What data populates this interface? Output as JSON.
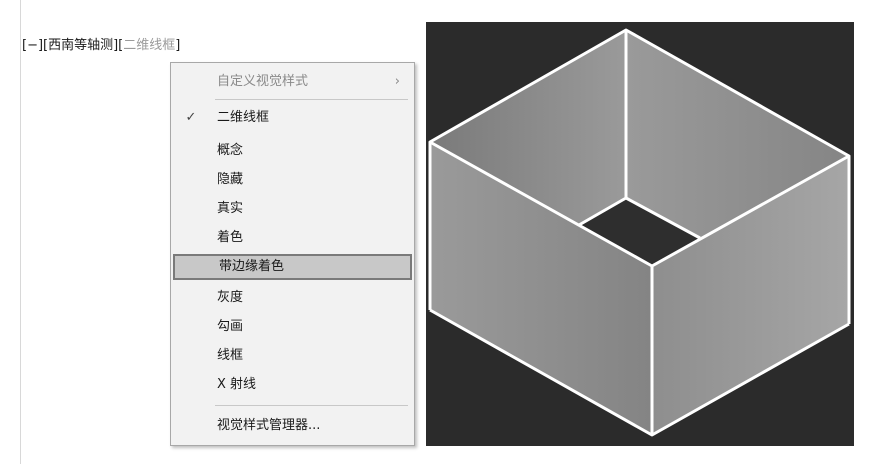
{
  "viewport_label": {
    "view_control": "[−][西南等轴测][",
    "visual_style": "二维线框",
    "close": "]"
  },
  "menu": {
    "header": "自定义视觉样式",
    "submenu_arrow": "›",
    "check_mark": "✓",
    "items": [
      "二维线框",
      "概念",
      "隐藏",
      "真实",
      "着色",
      "带边缘着色",
      "灰度",
      "勾画",
      "线框",
      "X 射线"
    ],
    "checked_item": "二维线框",
    "highlighted_item": "带边缘着色",
    "footer": "视觉样式管理器..."
  },
  "colors": {
    "viewport_bg": "#2b2b2b",
    "face_left": "#8a8a8a",
    "face_right": "#9a9a9a",
    "edges": "#ffffff"
  }
}
